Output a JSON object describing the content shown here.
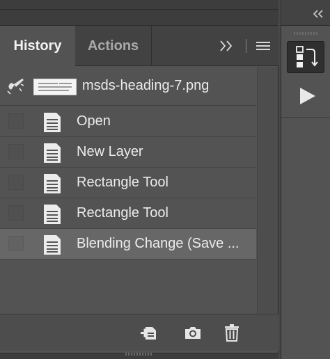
{
  "tabs": {
    "history_label": "History",
    "actions_label": "Actions"
  },
  "snapshot": {
    "file_name": "msds-heading-7.png"
  },
  "history_items": [
    {
      "label": "Open",
      "active": false
    },
    {
      "label": "New Layer",
      "active": false
    },
    {
      "label": "Rectangle Tool",
      "active": false
    },
    {
      "label": "Rectangle Tool",
      "active": false
    },
    {
      "label": "Blending Change (Save ...",
      "active": true
    }
  ],
  "icons": {
    "collapse": "double-chevron-left-icon",
    "panel_more": "double-chevron-right-icon",
    "panel_menu": "hamburger-menu-icon",
    "history_brush": "history-brush-icon",
    "history_step": "document-icon",
    "new_document": "new-document-from-state-icon",
    "snapshot": "camera-icon",
    "delete": "trash-icon",
    "dock_history": "history-panel-icon",
    "dock_actions": "play-icon"
  },
  "colors": {
    "panel_bg": "#535353",
    "tab_bar_bg": "#424242",
    "active_row_bg": "#676767",
    "text": "#ececec",
    "inactive_tab_text": "#a9a9a9"
  }
}
